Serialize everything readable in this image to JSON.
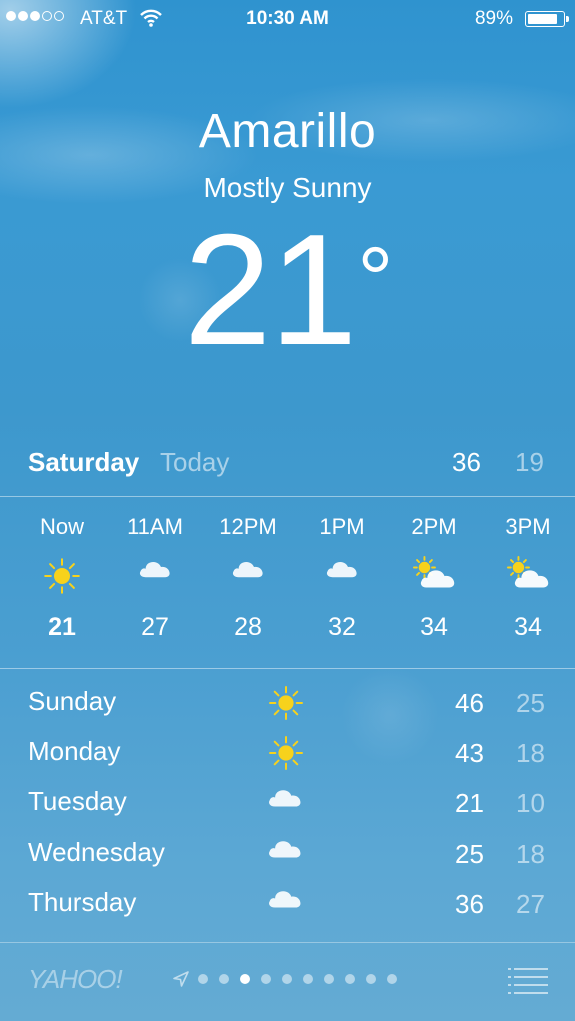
{
  "status_bar": {
    "carrier": "AT&T",
    "time": "10:30 AM",
    "battery_percent": "89%",
    "battery_level": 0.89,
    "signal_dots_on": 3,
    "signal_dots_total": 5
  },
  "location": {
    "city": "Amarillo",
    "condition": "Mostly Sunny",
    "temperature": "21",
    "degree_symbol": "°"
  },
  "today": {
    "day": "Saturday",
    "label": "Today",
    "high": "36",
    "low": "19"
  },
  "hourly": [
    {
      "time": "Now",
      "icon": "sun-icon",
      "temp": "21",
      "bold": true
    },
    {
      "time": "11AM",
      "icon": "cloud-icon",
      "temp": "27"
    },
    {
      "time": "12PM",
      "icon": "cloud-icon",
      "temp": "28"
    },
    {
      "time": "1PM",
      "icon": "cloud-icon",
      "temp": "32"
    },
    {
      "time": "2PM",
      "icon": "partly-cloudy-icon",
      "temp": "34"
    },
    {
      "time": "3PM",
      "icon": "partly-cloudy-icon",
      "temp": "34"
    }
  ],
  "daily": [
    {
      "day": "Sunday",
      "icon": "sun-icon",
      "high": "46",
      "low": "25"
    },
    {
      "day": "Monday",
      "icon": "sun-icon",
      "high": "43",
      "low": "18"
    },
    {
      "day": "Tuesday",
      "icon": "cloud-icon",
      "high": "21",
      "low": "10"
    },
    {
      "day": "Wednesday",
      "icon": "cloud-icon",
      "high": "25",
      "low": "18"
    },
    {
      "day": "Thursday",
      "icon": "cloud-icon",
      "high": "36",
      "low": "27"
    }
  ],
  "footer": {
    "brand": "YAHOO!",
    "page_count": 10,
    "active_page": 3
  },
  "colors": {
    "sun": "#f7d21c",
    "sky_top": "#2f93cf",
    "sky_bottom": "#64abd3"
  }
}
